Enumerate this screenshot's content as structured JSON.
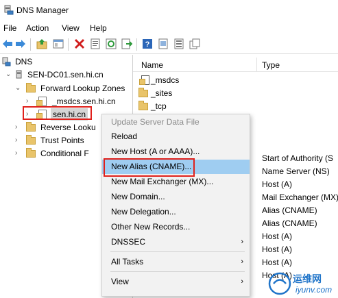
{
  "window": {
    "title": "DNS Manager"
  },
  "menubar": [
    "File",
    "Action",
    "View",
    "Help"
  ],
  "toolbar": {
    "icons": [
      "back-arrow-icon",
      "forward-arrow-icon",
      "folder-up-icon",
      "show-hide-tree-icon",
      "delete-icon",
      "properties-icon",
      "refresh-icon",
      "export-icon",
      "help-icon",
      "record-icon",
      "list-icon",
      "copy-icon"
    ]
  },
  "tree": {
    "root": "DNS",
    "server": "SEN-DC01.sen.hi.cn",
    "forward": "Forward Lookup Zones",
    "msdcs": "_msdcs.sen.hi.cn",
    "zone": "sen.hi.cn",
    "reverse": "Reverse Looku",
    "trust": "Trust Points",
    "conditional": "Conditional F"
  },
  "list": {
    "col_name": "Name",
    "col_type": "Type",
    "rows": [
      "_msdcs",
      "_sites",
      "_tcp"
    ],
    "types": [
      "Start of Authority (S",
      "Name Server (NS)",
      "Host (A)",
      "Mail Exchanger (MX)",
      "Alias (CNAME)",
      "Alias (CNAME)",
      "Host (A)",
      "Host (A)",
      "Host (A)",
      "Host (A)"
    ]
  },
  "context_menu": {
    "update": "Update Server Data File",
    "reload": "Reload",
    "new_host": "New Host (A or AAAA)...",
    "new_alias": "New Alias (CNAME)...",
    "new_mx": "New Mail Exchanger (MX)...",
    "new_domain": "New Domain...",
    "new_delegation": "New Delegation...",
    "other": "Other New Records...",
    "dnssec": "DNSSEC",
    "all_tasks": "All Tasks",
    "view": "View"
  },
  "watermark": {
    "text1": "运维网",
    "text2": "iyunv.com"
  },
  "colors": {
    "highlight": "#9fcdf1",
    "callout": "#e0201b",
    "watermark": "#1f74c9"
  }
}
